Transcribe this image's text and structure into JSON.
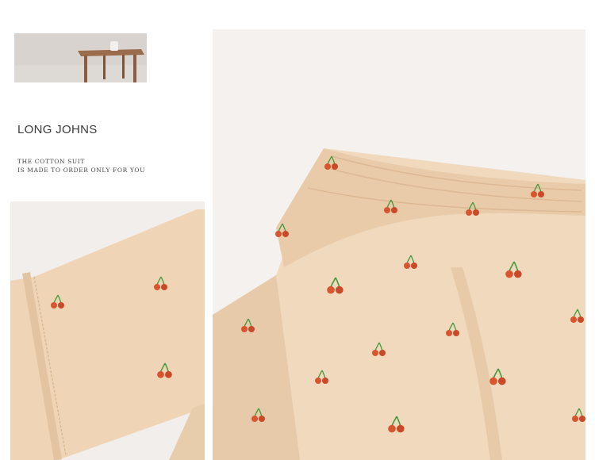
{
  "product": {
    "title": "LONG JOHNS",
    "tagline_line1": "THE COTTON SUIT",
    "tagline_line2": "IS MADE TO ORDER ONLY FOR YOU"
  },
  "images": {
    "thumbnail": "wooden stool with mug",
    "detail_left": "sleeve cuff with cherry print",
    "detail_right": "elastic waistband with cherry print"
  },
  "colors": {
    "fabric": "#f1d9bd",
    "fabric_shadow": "#e2c6a6",
    "cherry": "#d9552f",
    "leaf": "#3f9a3a",
    "backdrop": "#f4f1ee"
  }
}
